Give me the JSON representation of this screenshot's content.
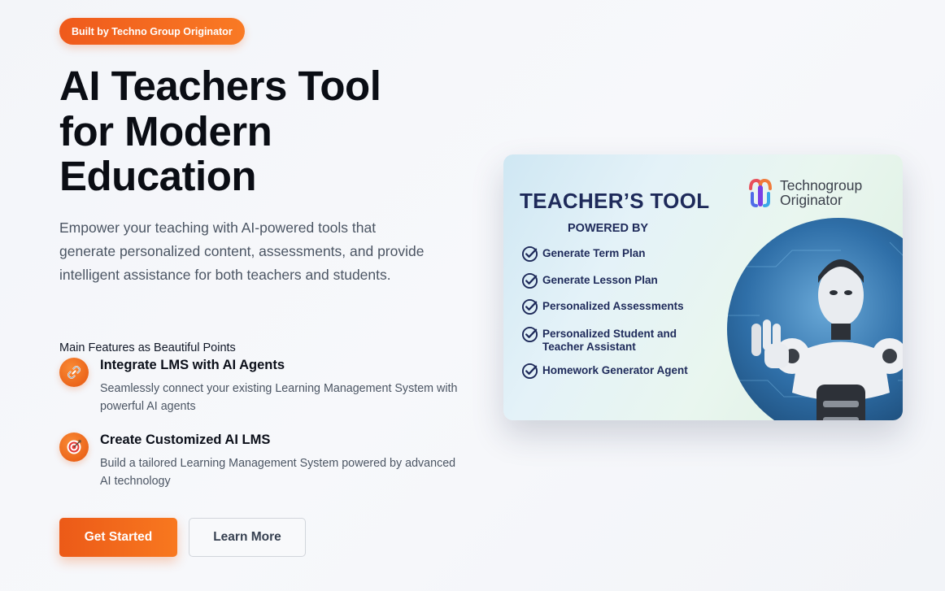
{
  "badge": "Built by Techno Group Originator",
  "hero": {
    "title_lines": [
      "AI Teachers Tool",
      "for Modern",
      "Education"
    ],
    "description": "Empower your teaching with AI-powered tools that generate personalized content, assessments, and provide intelligent assistance for both teachers and students."
  },
  "features": {
    "heading": "Main Features as Beautiful Points",
    "items": [
      {
        "icon": "link-icon",
        "title": "Integrate LMS with AI Agents",
        "description": "Seamlessly connect your existing Learning Management System with powerful AI agents"
      },
      {
        "icon": "target-icon",
        "title": "Create Customized AI LMS",
        "description": "Build a tailored Learning Management System powered by advanced AI technology"
      }
    ]
  },
  "buttons": {
    "primary": "Get Started",
    "secondary": "Learn More"
  },
  "promo": {
    "title": "TEACHER’S TOOL",
    "subtitle": "POWERED BY",
    "logo_lines": [
      "Technogroup",
      "Originator"
    ],
    "items": [
      [
        "Generate Term Plan"
      ],
      [
        "Generate Lesson Plan"
      ],
      [
        "Personalized Assessments"
      ],
      [
        "Personalized Student and",
        "Teacher Assistant"
      ],
      [
        "Homework Generator Agent"
      ]
    ]
  },
  "colors": {
    "accent": "#f26b1d",
    "navy": "#1e2a5a",
    "text_muted": "#4b5563"
  }
}
